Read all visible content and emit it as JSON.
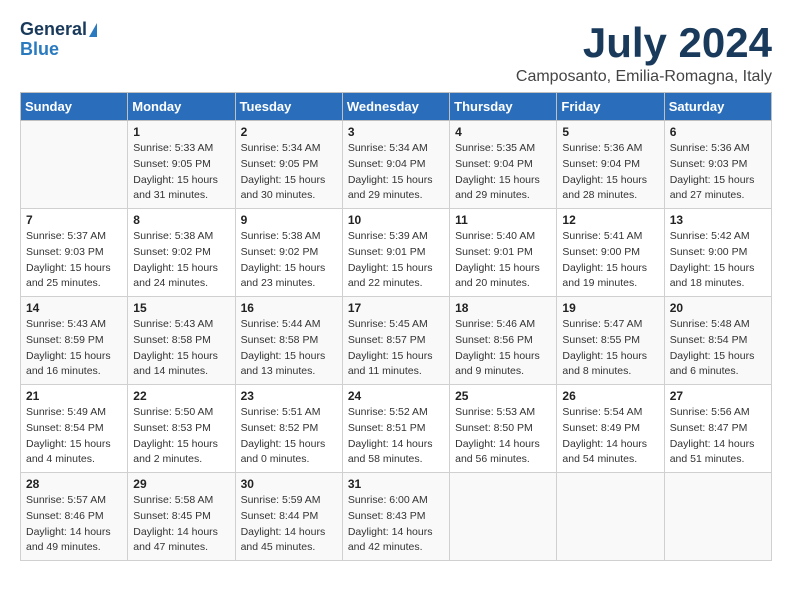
{
  "logo": {
    "line1": "General",
    "line2": "Blue"
  },
  "title": "July 2024",
  "location": "Camposanto, Emilia-Romagna, Italy",
  "days_of_week": [
    "Sunday",
    "Monday",
    "Tuesday",
    "Wednesday",
    "Thursday",
    "Friday",
    "Saturday"
  ],
  "weeks": [
    [
      {
        "day": "",
        "content": ""
      },
      {
        "day": "1",
        "content": "Sunrise: 5:33 AM\nSunset: 9:05 PM\nDaylight: 15 hours\nand 31 minutes."
      },
      {
        "day": "2",
        "content": "Sunrise: 5:34 AM\nSunset: 9:05 PM\nDaylight: 15 hours\nand 30 minutes."
      },
      {
        "day": "3",
        "content": "Sunrise: 5:34 AM\nSunset: 9:04 PM\nDaylight: 15 hours\nand 29 minutes."
      },
      {
        "day": "4",
        "content": "Sunrise: 5:35 AM\nSunset: 9:04 PM\nDaylight: 15 hours\nand 29 minutes."
      },
      {
        "day": "5",
        "content": "Sunrise: 5:36 AM\nSunset: 9:04 PM\nDaylight: 15 hours\nand 28 minutes."
      },
      {
        "day": "6",
        "content": "Sunrise: 5:36 AM\nSunset: 9:03 PM\nDaylight: 15 hours\nand 27 minutes."
      }
    ],
    [
      {
        "day": "7",
        "content": "Sunrise: 5:37 AM\nSunset: 9:03 PM\nDaylight: 15 hours\nand 25 minutes."
      },
      {
        "day": "8",
        "content": "Sunrise: 5:38 AM\nSunset: 9:02 PM\nDaylight: 15 hours\nand 24 minutes."
      },
      {
        "day": "9",
        "content": "Sunrise: 5:38 AM\nSunset: 9:02 PM\nDaylight: 15 hours\nand 23 minutes."
      },
      {
        "day": "10",
        "content": "Sunrise: 5:39 AM\nSunset: 9:01 PM\nDaylight: 15 hours\nand 22 minutes."
      },
      {
        "day": "11",
        "content": "Sunrise: 5:40 AM\nSunset: 9:01 PM\nDaylight: 15 hours\nand 20 minutes."
      },
      {
        "day": "12",
        "content": "Sunrise: 5:41 AM\nSunset: 9:00 PM\nDaylight: 15 hours\nand 19 minutes."
      },
      {
        "day": "13",
        "content": "Sunrise: 5:42 AM\nSunset: 9:00 PM\nDaylight: 15 hours\nand 18 minutes."
      }
    ],
    [
      {
        "day": "14",
        "content": "Sunrise: 5:43 AM\nSunset: 8:59 PM\nDaylight: 15 hours\nand 16 minutes."
      },
      {
        "day": "15",
        "content": "Sunrise: 5:43 AM\nSunset: 8:58 PM\nDaylight: 15 hours\nand 14 minutes."
      },
      {
        "day": "16",
        "content": "Sunrise: 5:44 AM\nSunset: 8:58 PM\nDaylight: 15 hours\nand 13 minutes."
      },
      {
        "day": "17",
        "content": "Sunrise: 5:45 AM\nSunset: 8:57 PM\nDaylight: 15 hours\nand 11 minutes."
      },
      {
        "day": "18",
        "content": "Sunrise: 5:46 AM\nSunset: 8:56 PM\nDaylight: 15 hours\nand 9 minutes."
      },
      {
        "day": "19",
        "content": "Sunrise: 5:47 AM\nSunset: 8:55 PM\nDaylight: 15 hours\nand 8 minutes."
      },
      {
        "day": "20",
        "content": "Sunrise: 5:48 AM\nSunset: 8:54 PM\nDaylight: 15 hours\nand 6 minutes."
      }
    ],
    [
      {
        "day": "21",
        "content": "Sunrise: 5:49 AM\nSunset: 8:54 PM\nDaylight: 15 hours\nand 4 minutes."
      },
      {
        "day": "22",
        "content": "Sunrise: 5:50 AM\nSunset: 8:53 PM\nDaylight: 15 hours\nand 2 minutes."
      },
      {
        "day": "23",
        "content": "Sunrise: 5:51 AM\nSunset: 8:52 PM\nDaylight: 15 hours\nand 0 minutes."
      },
      {
        "day": "24",
        "content": "Sunrise: 5:52 AM\nSunset: 8:51 PM\nDaylight: 14 hours\nand 58 minutes."
      },
      {
        "day": "25",
        "content": "Sunrise: 5:53 AM\nSunset: 8:50 PM\nDaylight: 14 hours\nand 56 minutes."
      },
      {
        "day": "26",
        "content": "Sunrise: 5:54 AM\nSunset: 8:49 PM\nDaylight: 14 hours\nand 54 minutes."
      },
      {
        "day": "27",
        "content": "Sunrise: 5:56 AM\nSunset: 8:47 PM\nDaylight: 14 hours\nand 51 minutes."
      }
    ],
    [
      {
        "day": "28",
        "content": "Sunrise: 5:57 AM\nSunset: 8:46 PM\nDaylight: 14 hours\nand 49 minutes."
      },
      {
        "day": "29",
        "content": "Sunrise: 5:58 AM\nSunset: 8:45 PM\nDaylight: 14 hours\nand 47 minutes."
      },
      {
        "day": "30",
        "content": "Sunrise: 5:59 AM\nSunset: 8:44 PM\nDaylight: 14 hours\nand 45 minutes."
      },
      {
        "day": "31",
        "content": "Sunrise: 6:00 AM\nSunset: 8:43 PM\nDaylight: 14 hours\nand 42 minutes."
      },
      {
        "day": "",
        "content": ""
      },
      {
        "day": "",
        "content": ""
      },
      {
        "day": "",
        "content": ""
      }
    ]
  ]
}
